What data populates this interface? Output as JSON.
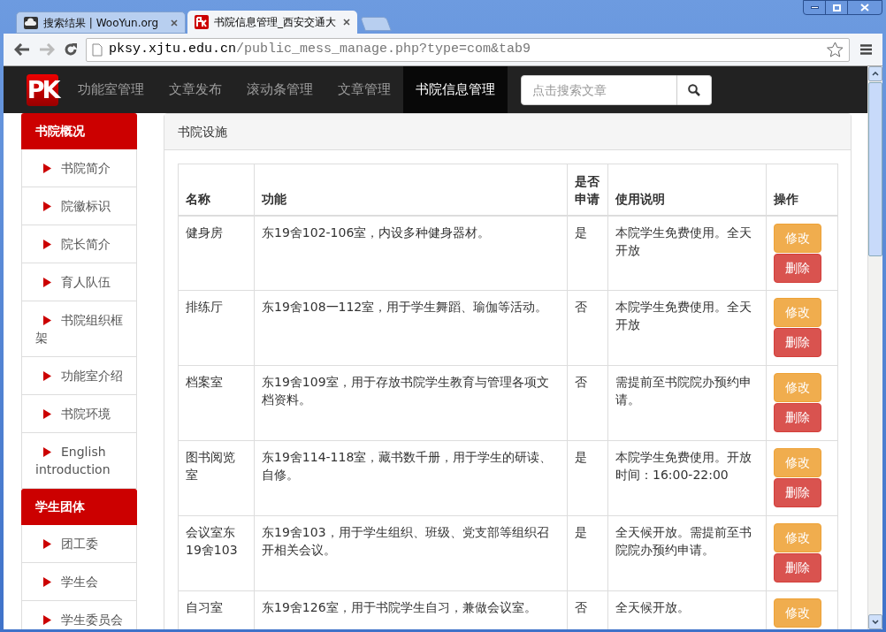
{
  "browser": {
    "tabs": [
      {
        "title": "搜索结果 | WooYun.org",
        "kind": "cloud",
        "selected": false
      },
      {
        "title": "书院信息管理_西安交通大",
        "kind": "logo",
        "selected": true
      }
    ],
    "address": {
      "host": "pksy.xjtu.edu.cn",
      "path": "/public_mess_manage.php?type=com&tab9"
    }
  },
  "navbar": {
    "logo": "PK",
    "items": [
      {
        "label": "功能室管理",
        "selected": false
      },
      {
        "label": "文章发布",
        "selected": false
      },
      {
        "label": "滚动条管理",
        "selected": false
      },
      {
        "label": "文章管理",
        "selected": false
      },
      {
        "label": "书院信息管理",
        "selected": true
      }
    ],
    "search": {
      "placeholder": "点击搜索文章"
    }
  },
  "sidebar": [
    {
      "title": "书院概况",
      "items": [
        "书院简介",
        "院徽标识",
        "院长简介",
        "育人队伍",
        "书院组织框架",
        "功能室介绍",
        "书院环境",
        "English introduction"
      ]
    },
    {
      "title": "学生团体",
      "items": [
        "团工委",
        "学生会",
        "学生委员会"
      ]
    }
  ],
  "panel": {
    "title": "书院设施",
    "table": {
      "columns": [
        "名称",
        "功能",
        "是否申请",
        "使用说明",
        "操作"
      ],
      "rows": [
        {
          "cells": [
            "健身房",
            "东19舍102-106室，内设多种健身器材。",
            "是",
            "本院学生免费使用。全天开放"
          ],
          "actions": [
            {
              "label": "修改",
              "kind": "edit"
            },
            {
              "label": "删除",
              "kind": "delete"
            }
          ]
        },
        {
          "cells": [
            "排练厅",
            "东19舍108一112室，用于学生舞蹈、瑜伽等活动。",
            "否",
            "本院学生免费使用。全天开放"
          ],
          "actions": [
            {
              "label": "修改",
              "kind": "edit"
            },
            {
              "label": "删除",
              "kind": "delete"
            }
          ]
        },
        {
          "cells": [
            "档案室",
            "东19舍109室，用于存放书院学生教育与管理各项文档资料。",
            "否",
            "需提前至书院院办预约申请。"
          ],
          "actions": [
            {
              "label": "修改",
              "kind": "edit"
            },
            {
              "label": "删除",
              "kind": "delete"
            }
          ]
        },
        {
          "cells": [
            "图书阅览室",
            "东19舍114-118室，藏书数千册，用于学生的研读、自修。",
            "是",
            "本院学生免费使用。开放时间：16:00-22:00"
          ],
          "actions": [
            {
              "label": "修改",
              "kind": "edit"
            },
            {
              "label": "删除",
              "kind": "delete"
            }
          ]
        },
        {
          "cells": [
            "会议室东19舍103",
            "东19舍103，用于学生组织、班级、党支部等组织召开相关会议。",
            "是",
            "全天候开放。需提前至书院院办预约申请。"
          ],
          "actions": [
            {
              "label": "修改",
              "kind": "edit"
            },
            {
              "label": "删除",
              "kind": "delete"
            }
          ]
        },
        {
          "cells": [
            "自习室",
            "东19舍126室，用于书院学生自习，兼做会议室。",
            "否",
            "全天候开放。"
          ],
          "actions": [
            {
              "label": "修改",
              "kind": "edit"
            }
          ]
        }
      ]
    }
  }
}
